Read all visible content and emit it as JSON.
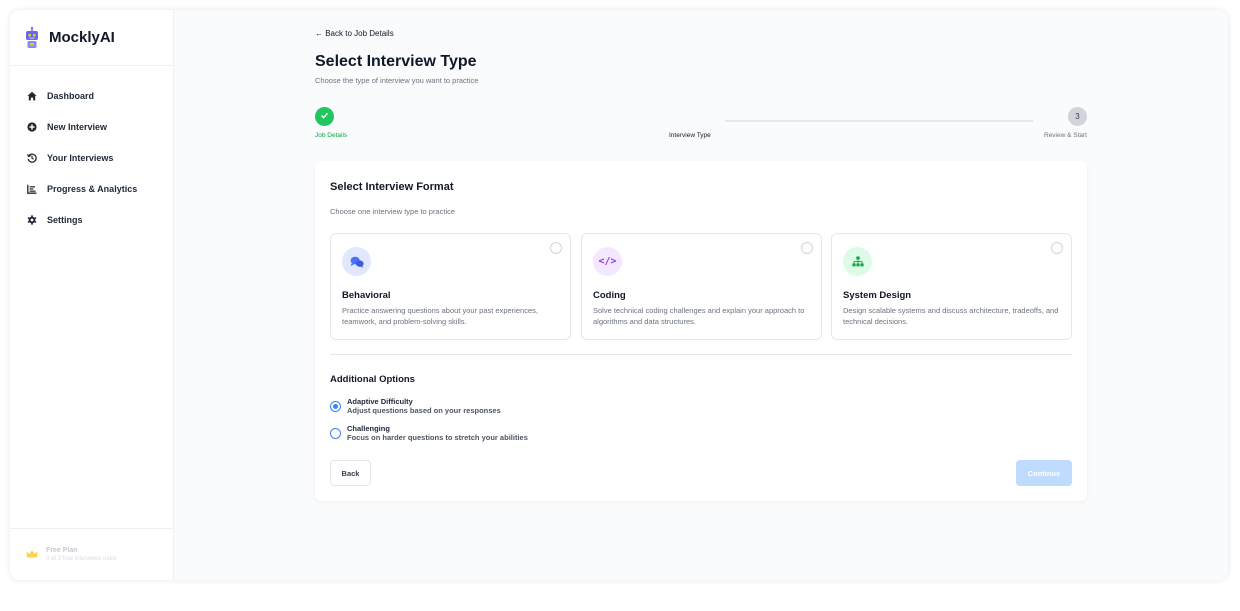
{
  "app": {
    "name": "MocklyAI",
    "logo_icon": "robot-icon"
  },
  "sidebar": {
    "items": [
      {
        "label": "Dashboard",
        "icon": "home-icon"
      },
      {
        "label": "New Interview",
        "icon": "plus-circle-icon"
      },
      {
        "label": "Your Interviews",
        "icon": "history-icon"
      },
      {
        "label": "Progress & Analytics",
        "icon": "chart-icon"
      },
      {
        "label": "Settings",
        "icon": "gear-icon"
      }
    ],
    "plan": {
      "title": "Free Plan",
      "subtitle": "0 of 3 free interviews used",
      "icon": "crown-icon"
    }
  },
  "header": {
    "back_link": "← Back to Job Details",
    "title": "Select Interview Type",
    "subtitle": "Choose the type of interview you want to practice"
  },
  "stepper": {
    "steps": [
      {
        "label": "Job Details",
        "status": "completed",
        "number": ""
      },
      {
        "label": "Interview Type",
        "status": "current",
        "number": ""
      },
      {
        "label": "Review & Start",
        "status": "upcoming",
        "number": "3"
      }
    ]
  },
  "format": {
    "title": "Select Interview Format",
    "subtitle": "Choose one interview type to practice",
    "types": [
      {
        "title": "Behavioral",
        "description": "Practice answering questions about your past experiences, teamwork, and problem-solving skills.",
        "icon": "chat-bubbles-icon",
        "icon_color": "#4f6ef7",
        "icon_bg": "#e0e7ff"
      },
      {
        "title": "Coding",
        "description": "Solve technical coding challenges and explain your approach to algorithms and data structures.",
        "icon": "code-icon",
        "icon_glyph": "</>",
        "icon_color": "#9333ea",
        "icon_bg": "#f3e8ff"
      },
      {
        "title": "System Design",
        "description": "Design scalable systems and discuss architecture, tradeoffs, and technical decisions.",
        "icon": "sitemap-icon",
        "icon_color": "#16a34a",
        "icon_bg": "#dcfce7"
      }
    ]
  },
  "options": {
    "title": "Additional Options",
    "items": [
      {
        "label": "Adaptive Difficulty",
        "description": "Adjust questions based on your responses",
        "selected": true
      },
      {
        "label": "Challenging",
        "description": "Focus on harder questions to stretch your abilities",
        "selected": false
      }
    ]
  },
  "actions": {
    "back": "Back",
    "continue": "Continue"
  },
  "colors": {
    "accent": "#3b82f6",
    "success": "#22c55e",
    "continue_disabled": "#bfdbfe"
  }
}
